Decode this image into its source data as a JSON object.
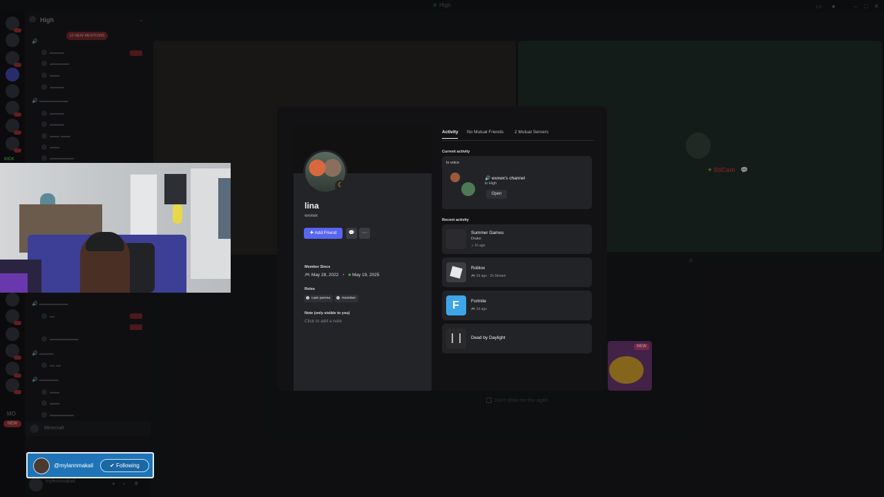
{
  "window": {
    "title": "High"
  },
  "sidebar": {
    "server_name": "High",
    "mentions_label": "12 NEW MENTIONS",
    "minecraft": "Minecraft",
    "user_name": "mylennmakail"
  },
  "rail": {
    "kick": "KICK",
    "mo": "MO",
    "new_label": "NEW"
  },
  "stage": {
    "stream_name": "StiCam",
    "promo_badge": "NEW",
    "dont_show": "Don't show me this again"
  },
  "follow": {
    "handle": "@mylannmakail",
    "button": "Following"
  },
  "profile": {
    "display_name": "lina",
    "username": "wvxwx",
    "add_friend": "Add Friend",
    "member_since_label": "Member Since",
    "discord_date": "May 28, 2022",
    "server_date": "May 19, 2025",
    "roles_label": "Roles",
    "roles": [
      "cam perms",
      "member"
    ],
    "note_label": "Note (only visible to you)",
    "note_placeholder": "Click to add a note",
    "tabs": [
      "Activity",
      "No Mutual Friends",
      "2 Mutual Servers"
    ],
    "current_activity_label": "Current activity",
    "in_voice_label": "In voice",
    "voice_channel": "wvxwx's channel",
    "voice_server": "in High",
    "open_label": "Open",
    "recent_activity_label": "Recent activity",
    "activities": [
      {
        "name": "Summer Games",
        "sub": "Drake",
        "meta": "1h ago",
        "color": "#2b2b2e"
      },
      {
        "name": "Roblox",
        "sub": "",
        "meta": "2d ago  ·  1h Stream",
        "color": "#3b3d42"
      },
      {
        "name": "Fortnite",
        "sub": "",
        "meta": "2d ago",
        "color": "#3ea6e8"
      },
      {
        "name": "Dead by Daylight",
        "sub": "",
        "meta": "",
        "color": "#2a2a2c"
      }
    ]
  },
  "colors": {
    "accent": "#5865f2",
    "follow_bg": "#1e74b7",
    "live": "#8a2d31"
  }
}
